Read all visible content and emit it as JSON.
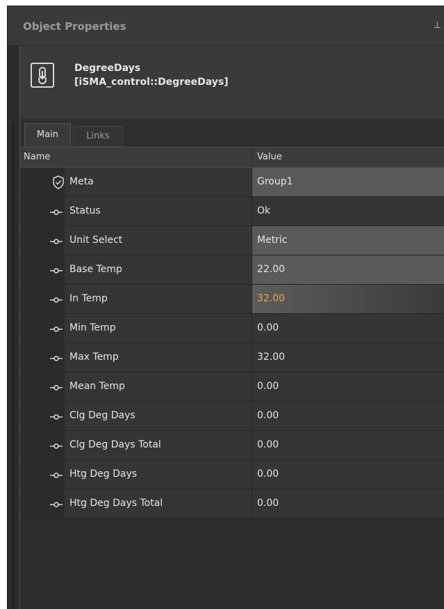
{
  "panel": {
    "title": "Object Properties",
    "pin_icon": "pin-icon"
  },
  "object": {
    "icon": "thermometer-icon",
    "name": "DegreeDays",
    "type": "[iSMA_control::DegreeDays]"
  },
  "tabs": [
    {
      "label": "Main",
      "active": true
    },
    {
      "label": "Links",
      "active": false
    }
  ],
  "grid": {
    "columns": {
      "name": "Name",
      "value": "Value"
    },
    "rows": [
      {
        "icon": "shield-icon",
        "name": "Meta",
        "value": "Group1",
        "style": "editable"
      },
      {
        "icon": "slot-icon",
        "name": "Status",
        "value": "Ok",
        "style": "plain"
      },
      {
        "icon": "slot-icon",
        "name": "Unit Select",
        "value": "Metric",
        "style": "editable"
      },
      {
        "icon": "slot-icon",
        "name": "Base Temp",
        "value": "22.00",
        "style": "editable"
      },
      {
        "icon": "slot-icon",
        "name": "In Temp",
        "value": "32.00",
        "style": "highlight"
      },
      {
        "icon": "slot-icon",
        "name": "Min Temp",
        "value": "0.00",
        "style": "plain"
      },
      {
        "icon": "slot-icon",
        "name": "Max Temp",
        "value": "32.00",
        "style": "plain"
      },
      {
        "icon": "slot-icon",
        "name": "Mean Temp",
        "value": "0.00",
        "style": "plain"
      },
      {
        "icon": "slot-icon",
        "name": "Clg Deg Days",
        "value": "0.00",
        "style": "plain"
      },
      {
        "icon": "slot-icon",
        "name": "Clg Deg Days Total",
        "value": "0.00",
        "style": "plain"
      },
      {
        "icon": "slot-icon",
        "name": "Htg Deg Days",
        "value": "0.00",
        "style": "plain"
      },
      {
        "icon": "slot-icon",
        "name": "Htg Deg Days Total",
        "value": "0.00",
        "style": "plain"
      }
    ]
  },
  "colors": {
    "background": "#2b2b2b",
    "highlight_value": "#e9a93c",
    "editable_value_bg": "#5a5a5a"
  }
}
